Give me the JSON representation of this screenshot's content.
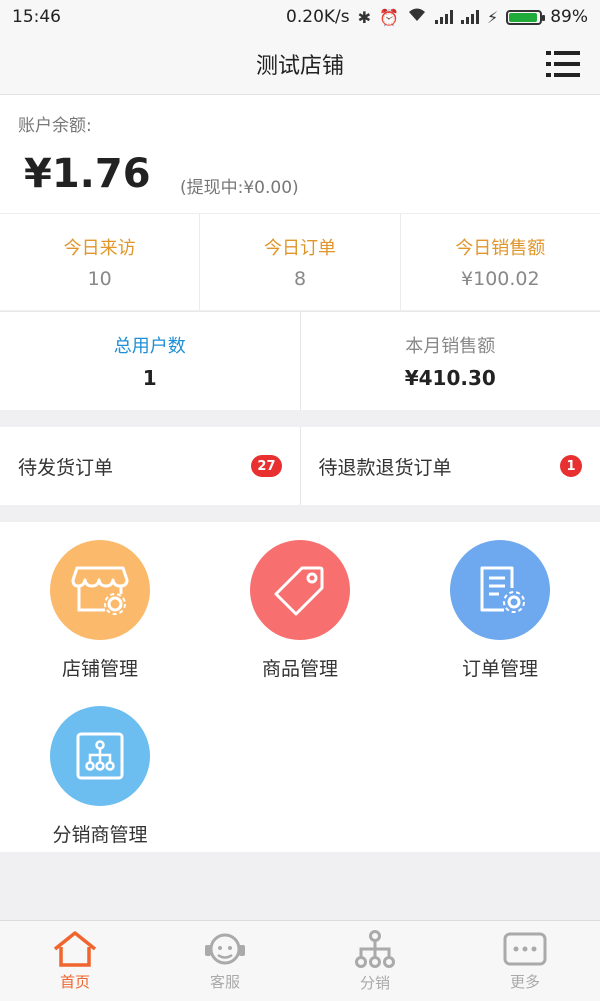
{
  "status": {
    "time": "15:46",
    "speed": "0.20K/s",
    "battery": "89%"
  },
  "header": {
    "title": "测试店铺"
  },
  "balance": {
    "label": "账户余额:",
    "amount": "¥1.76",
    "pending": "(提现中:¥0.00)"
  },
  "stats_today": [
    {
      "label": "今日来访",
      "value": "10"
    },
    {
      "label": "今日订单",
      "value": "8"
    },
    {
      "label": "今日销售额",
      "value": "¥100.02"
    }
  ],
  "stats_total": [
    {
      "label": "总用户数",
      "value": "1",
      "color": "#1f8fd6"
    },
    {
      "label": "本月销售额",
      "value": "¥410.30",
      "color": "#888888"
    }
  ],
  "orders": [
    {
      "label": "待发货订单",
      "count": "27"
    },
    {
      "label": "待退款退货订单",
      "count": "1"
    }
  ],
  "grid": [
    {
      "label": "店铺管理",
      "color": "#fbb96b",
      "icon": "store-gear-icon"
    },
    {
      "label": "商品管理",
      "color": "#f86f6f",
      "icon": "price-tag-icon"
    },
    {
      "label": "订单管理",
      "color": "#6ea8ef",
      "icon": "document-gear-icon"
    },
    {
      "label": "分销商管理",
      "color": "#6cbdf0",
      "icon": "org-chart-icon"
    }
  ],
  "tabs": [
    {
      "label": "首页",
      "icon": "home-icon",
      "active": true
    },
    {
      "label": "客服",
      "icon": "customer-service-icon",
      "active": false
    },
    {
      "label": "分销",
      "icon": "distribution-icon",
      "active": false
    },
    {
      "label": "更多",
      "icon": "more-icon",
      "active": false
    }
  ],
  "colors": {
    "accent_orange": "#e0962a",
    "tab_active": "#f0642d",
    "tab_inactive": "#aaaaaa",
    "badge_red": "#e83030"
  }
}
